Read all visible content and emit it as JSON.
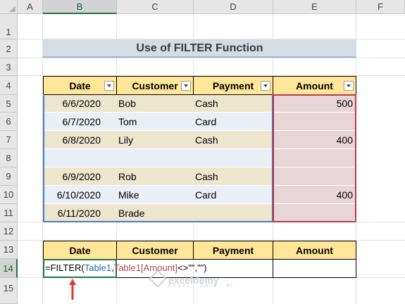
{
  "columns": [
    "A",
    "B",
    "C",
    "D",
    "E",
    "F"
  ],
  "rows": [
    "1",
    "2",
    "3",
    "4",
    "5",
    "6",
    "7",
    "8",
    "9",
    "10",
    "11",
    "12",
    "13",
    "14",
    "15"
  ],
  "selected_column": "B",
  "selected_row": "14",
  "title": "Use of FILTER Function",
  "table1": {
    "headers": [
      "Date",
      "Customer",
      "Payment",
      "Amount"
    ],
    "rows": [
      [
        "6/6/2020",
        "Bob",
        "Cash",
        "500"
      ],
      [
        "6/7/2020",
        "Tom",
        "Card",
        ""
      ],
      [
        "6/8/2020",
        "Lily",
        "Cash",
        "400"
      ],
      [
        "",
        "",
        "",
        ""
      ],
      [
        "6/9/2020",
        "Rob",
        "Cash",
        ""
      ],
      [
        "6/10/2020",
        "Mike",
        "Card",
        "400"
      ],
      [
        "6/11/2020",
        "Brade",
        "",
        ""
      ]
    ]
  },
  "table2": {
    "headers": [
      "Date",
      "Customer",
      "Payment",
      "Amount"
    ]
  },
  "formula": {
    "prefix": "=FILTER(",
    "ref1": "Table1",
    "sep": ",",
    "ref2": "Table1[Amount]",
    "suffix": "<>\"\",\"\")"
  },
  "watermark": {
    "name": "exceldemy",
    "tagline": "EXCEL · DATA · BI"
  },
  "colors": {
    "header_fill": "#ffe699",
    "band_tan": "#ede6cf",
    "band_blue": "#e9eef7",
    "amount_pink": "#e8d5d7",
    "formula_border": "#217346",
    "arrow": "#e03a2f"
  }
}
